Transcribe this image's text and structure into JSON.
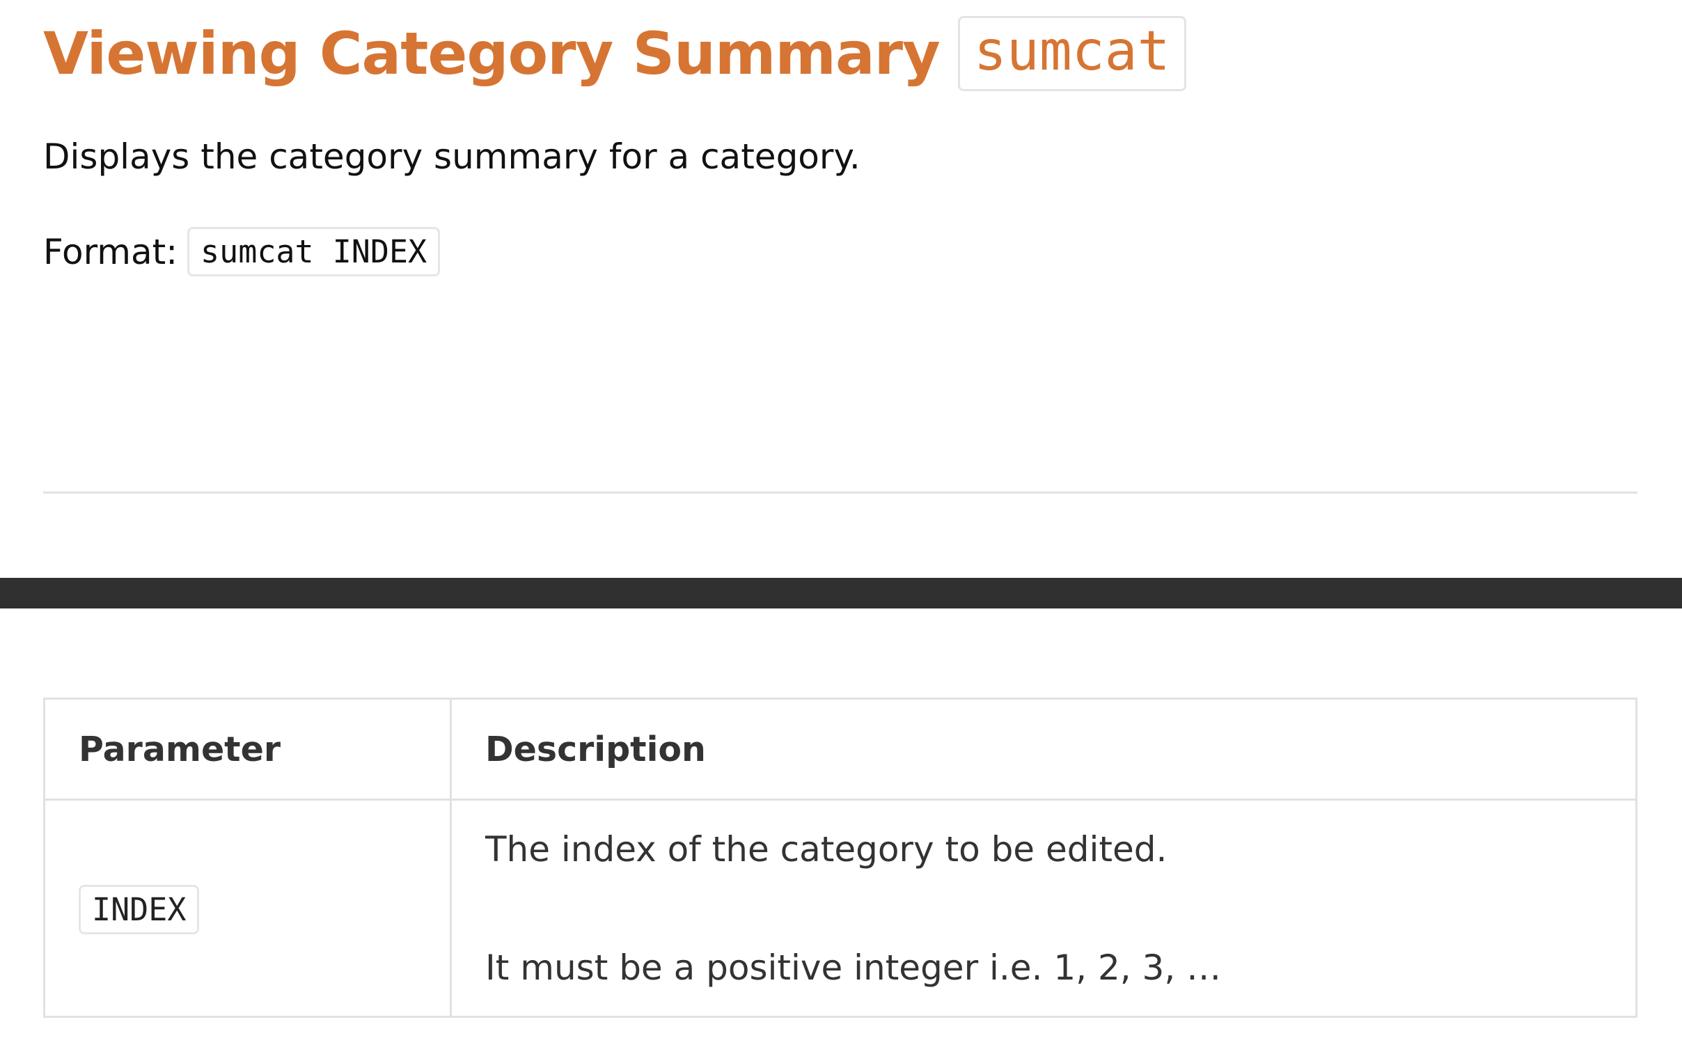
{
  "heading": {
    "title": "Viewing Category Summary",
    "command": "sumcat"
  },
  "description": "Displays the category summary for a category.",
  "format": {
    "label": "Format:",
    "syntax": "sumcat INDEX"
  },
  "parameters_table": {
    "headers": {
      "parameter": "Parameter",
      "description": "Description"
    },
    "rows": [
      {
        "parameter": "INDEX",
        "description_lines": [
          "The index of the category to be edited.",
          "It must be a positive integer i.e. 1, 2, 3, …"
        ]
      }
    ]
  },
  "colors": {
    "heading": "#d67533",
    "text": "#111111",
    "table_text": "#333333",
    "dark_bar": "#303030",
    "border": "#e1e1e1"
  }
}
